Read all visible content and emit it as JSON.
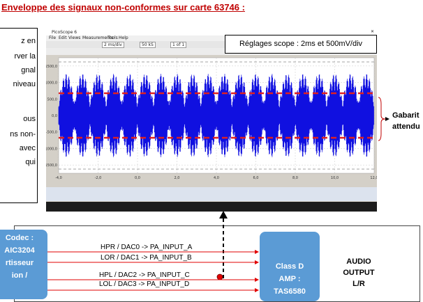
{
  "title": "Enveloppe des signaux non-conformes sur carte 63746 :",
  "left_text": [
    "z en",
    "rver la",
    "gnal",
    "niveau",
    "ous",
    "ns non-",
    "avec",
    "qui"
  ],
  "scope": {
    "window_title": "PicoScope 6",
    "menu": [
      "File",
      "Edit",
      "Views",
      "Measurements",
      "Tools",
      "Help"
    ],
    "timebase": "2 ms/div",
    "samples": "50 kS",
    "capture": "1 of 1",
    "y_ticks": [
      "1500,0",
      "1000,0",
      "500,0",
      "0,0",
      "-500,0",
      "-1000,0",
      "-1500,0"
    ],
    "x_ticks": [
      "-4,0",
      "-2,0",
      "0,0",
      "2,0",
      "4,0",
      "6,0",
      "8,0",
      "10,0",
      "12,0"
    ],
    "colors": {
      "signal": "#1010e0",
      "template": "#e02020",
      "grid": "#c8c8c8"
    }
  },
  "reglages": "Réglages scope : 2ms et  500mV/div",
  "gabarit": [
    "Gabarit",
    "attendu"
  ],
  "codec_lines": [
    "Codec :",
    "AIC3204",
    "rtisseur",
    "ion /"
  ],
  "classd_lines": [
    "Class D",
    "AMP :",
    "TAS6580"
  ],
  "audio_lines": [
    "AUDIO",
    "OUTPUT",
    "L/R"
  ],
  "signals": [
    "HPR / DAC0 -> PA_INPUT_A",
    "LOR / DAC1 -> PA_INPUT_B",
    "HPL / DAC2 -> PA_INPUT_C",
    "LOL / DAC3 -> PA_INPUT_D"
  ]
}
